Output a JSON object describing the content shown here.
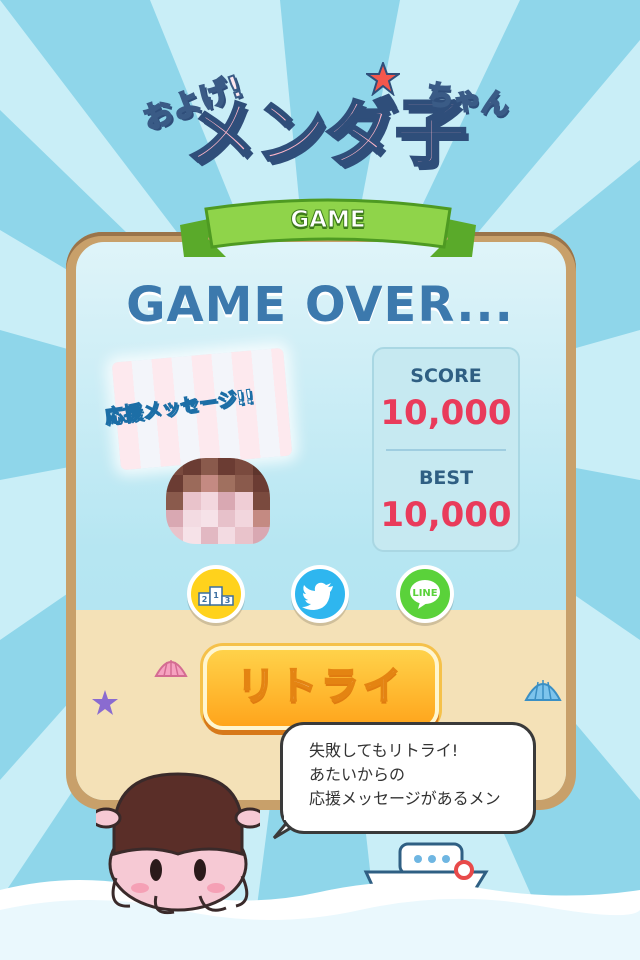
{
  "logo": {
    "prefix": "およげ!",
    "main": "メンダ子",
    "suffix": "ちゃん"
  },
  "ribbon": {
    "label": "GAME"
  },
  "result": {
    "title": "GAME OVER..."
  },
  "score": {
    "score_label": "SCORE",
    "score_value": "10,000",
    "best_label": "BEST",
    "best_value": "10,000"
  },
  "message_card": {
    "tag": "応援メッセージ!!"
  },
  "social": {
    "ranking_icon": "ranking-podium-icon",
    "ranking_digits": "213",
    "twitter_icon": "twitter-bird-icon",
    "line_icon": "line-icon",
    "line_label": "LINE"
  },
  "retry": {
    "label": "リトライ"
  },
  "speech": {
    "lines": [
      "失敗してもリトライ!",
      "あたいからの",
      "応援メッセージがあるメン"
    ]
  },
  "colors": {
    "accent_red": "#e93b5b",
    "title_blue": "#3c79ad",
    "ribbon_green": "#7fcc3c",
    "retry_orange": "#ffa51c"
  }
}
